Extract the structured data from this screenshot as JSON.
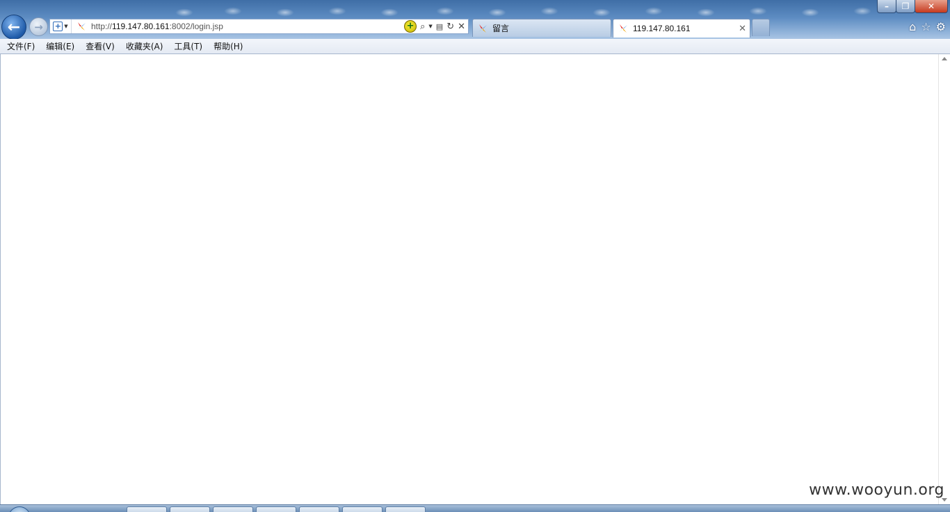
{
  "window": {
    "minimize_label": "–",
    "restore_label": "❐",
    "close_label": "✕"
  },
  "nav": {
    "back_label": "←",
    "forward_label": "→"
  },
  "address": {
    "url_prefix": "http://",
    "url_host": "119.147.80.161",
    "url_path": ":8002/login.jsp",
    "compat_icon": "compat-view-icon",
    "go_icon": "go-icon",
    "search_icon": "search-icon",
    "refresh_icon": "refresh-icon",
    "stop_icon": "stop-icon"
  },
  "tabs": [
    {
      "label": "留言",
      "active": false
    },
    {
      "label": "119.147.80.161",
      "active": true
    }
  ],
  "tab_close_label": "✕",
  "toolbar_right": [
    "home-icon",
    "favorites-star-icon",
    "gear-icon"
  ],
  "menu": [
    {
      "label": "文件(F)"
    },
    {
      "label": "编辑(E)"
    },
    {
      "label": "查看(V)"
    },
    {
      "label": "收藏夹(A)"
    },
    {
      "label": "工具(T)"
    },
    {
      "label": "帮助(H)"
    }
  ],
  "watermark": "www.wooyun.org",
  "colors": {
    "chrome_top": "#3f6ea6",
    "chrome_bottom": "#a9c5e4",
    "back_button": "#1e5aa8",
    "close_button": "#c63a1e",
    "menubar": "#e4eaf3",
    "content_bg": "#ffffff"
  }
}
